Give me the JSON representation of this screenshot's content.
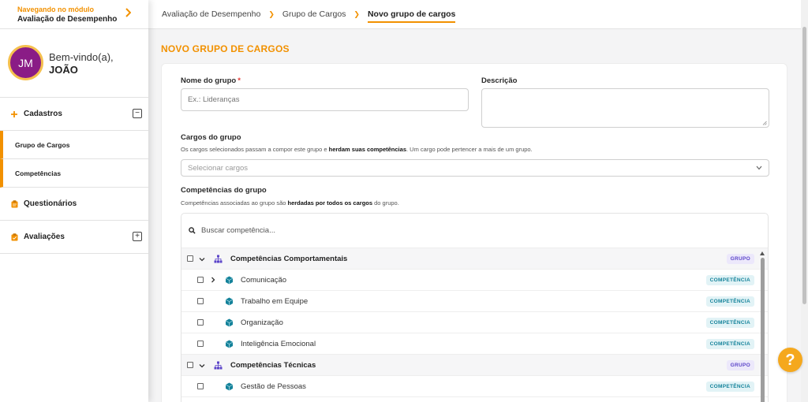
{
  "sidebar": {
    "module_label": "Navegando no módulo",
    "module_name": "Avaliação de Desempenho",
    "avatar_initials": "JM",
    "welcome_text": "Bem-vindo(a),",
    "user_name": "JOÃO",
    "menu": {
      "cadastros": {
        "label": "Cadastros",
        "toggle": "−"
      },
      "sub_items": [
        "Grupo de Cargos",
        "Competências"
      ],
      "questionarios": {
        "label": "Questionários"
      },
      "avaliacoes": {
        "label": "Avaliações",
        "toggle": "+"
      }
    }
  },
  "breadcrumb": [
    "Avaliação de Desempenho",
    "Grupo de Cargos",
    "Novo grupo de cargos"
  ],
  "page": {
    "title": "NOVO GRUPO DE CARGOS",
    "nome": {
      "label": "Nome do grupo",
      "required_mark": "*",
      "placeholder": "Ex.: Lideranças"
    },
    "descricao": {
      "label": "Descrição"
    },
    "cargos": {
      "label": "Cargos do grupo",
      "help_before": "Os cargos selecionados passam a compor este grupo e ",
      "help_bold": "herdam suas competências",
      "help_after": ". Um cargo pode pertencer a mais de um grupo.",
      "placeholder": "Selecionar cargos"
    },
    "competencias": {
      "label": "Competências do grupo",
      "help_before": "Competências associadas ao grupo são ",
      "help_bold": "herdadas por todos os cargos",
      "help_after": " do grupo.",
      "search_placeholder": "Buscar competência..."
    }
  },
  "tree": {
    "group_badge": "GRUPO",
    "comp_badge": "COMPETÊNCIA",
    "rows": [
      {
        "type": "group",
        "label": "Competências Comportamentais"
      },
      {
        "type": "child",
        "label": "Comunicação",
        "expandable": true
      },
      {
        "type": "child",
        "label": "Trabalho em Equipe"
      },
      {
        "type": "child",
        "label": "Organização"
      },
      {
        "type": "child",
        "label": "Inteligência Emocional"
      },
      {
        "type": "group",
        "label": "Competências Técnicas"
      },
      {
        "type": "child",
        "label": "Gestão de Pessoas"
      }
    ]
  },
  "colors": {
    "accent": "#f29100",
    "avatar": "#8a1c86",
    "group_badge": "#5b44c9",
    "comp_badge": "#14829a"
  },
  "help_fab": {
    "glyph": "?"
  }
}
